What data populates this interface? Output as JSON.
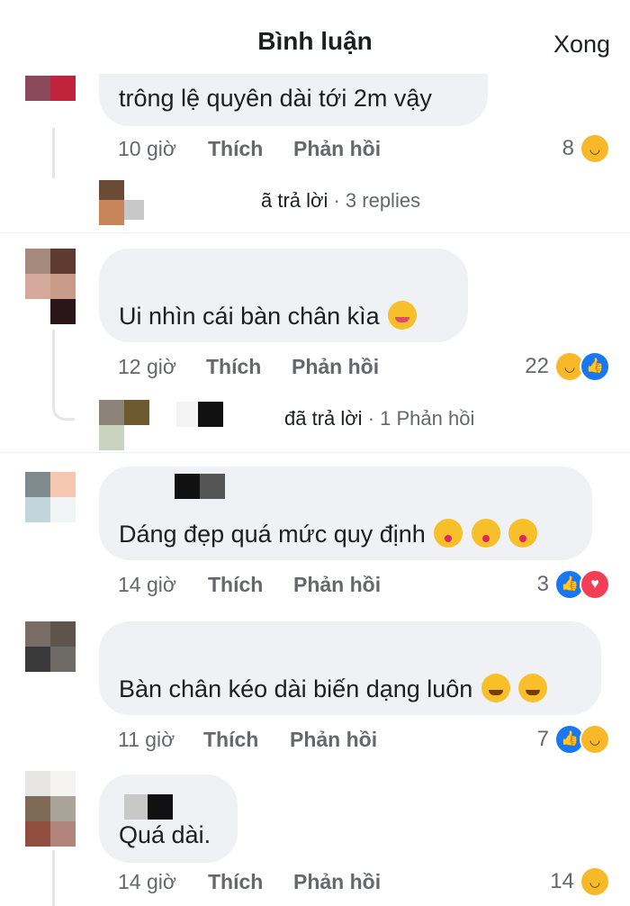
{
  "header": {
    "title": "Bình luận",
    "done": "Xong"
  },
  "comments": [
    {
      "text": "trông lệ quyên dài tới 2m vậy",
      "emojis": [],
      "time": "10 giờ",
      "like": "Thích",
      "reply": "Phản hồi",
      "count": "8",
      "reactions": [
        "haha-icon"
      ],
      "replies_text": "ã trả lời",
      "replies_count": "· 3 replies"
    },
    {
      "text": "Ui nhìn cái bàn chân kìa",
      "emojis": [
        "zany-face-icon"
      ],
      "time": "12 giờ",
      "like": "Thích",
      "reply": "Phản hồi",
      "count": "22",
      "reactions": [
        "haha-icon",
        "like-icon"
      ],
      "replies_text": "đã trả lời",
      "replies_count": "· 1 Phản hồi"
    },
    {
      "text": "Dáng đẹp quá mức quy định",
      "emojis": [
        "kissing-heart-icon",
        "kissing-heart-icon",
        "kissing-heart-icon"
      ],
      "time": "14 giờ",
      "like": "Thích",
      "reply": "Phản hồi",
      "count": "3",
      "reactions": [
        "like-icon",
        "love-icon"
      ]
    },
    {
      "text": "Bàn chân kéo dài biến dạng luôn",
      "emojis": [
        "rofl-icon",
        "rofl-icon"
      ],
      "time": "11 giờ",
      "like": "Thích",
      "reply": "Phản hồi",
      "count": "7",
      "reactions": [
        "like-icon",
        "haha-icon"
      ]
    },
    {
      "text": "Quá dài.",
      "emojis": [],
      "time": "14 giờ",
      "like": "Thích",
      "reply": "Phản hồi",
      "count": "14",
      "reactions": [
        "haha-icon"
      ]
    }
  ],
  "colors": {
    "bubble": "#eff1f4",
    "meta": "#65676b",
    "like": "#1877f2",
    "haha": "#f7b928",
    "love": "#f33e58"
  }
}
